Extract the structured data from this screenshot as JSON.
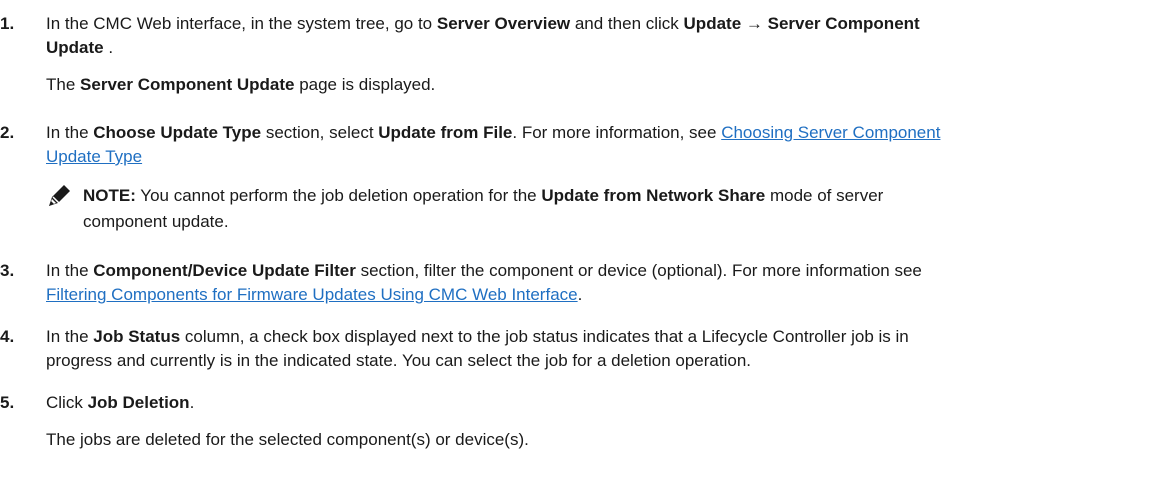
{
  "steps": [
    {
      "number": "1.",
      "line1": {
        "t1": "In the CMC Web interface, in the system tree, go to ",
        "b1": "Server Overview",
        "t2": " and then click ",
        "b2": "Update",
        "t3": " → ",
        "b3": "Server Component"
      },
      "line2": {
        "b1": "Update",
        "t1": " ."
      },
      "result": {
        "t1": "The ",
        "b1": "Server Component Update",
        "t2": " page is displayed."
      }
    },
    {
      "number": "2.",
      "line1": {
        "t1": "In the ",
        "b1": "Choose Update Type",
        "t2": " section, select ",
        "b2": "Update from File",
        "t3": ". For more information, see ",
        "link": "Choosing Server Component"
      },
      "line2": {
        "link": "Update Type"
      },
      "note": {
        "label": "NOTE:",
        "t1": " You cannot perform the job deletion operation for the ",
        "b1": "Update from Network Share",
        "t2": " mode of server",
        "line2": "component update."
      }
    },
    {
      "number": "3.",
      "line1": {
        "t1": "In the ",
        "b1": "Component/Device Update Filter",
        "t2": " section, filter the component or device (optional). For more information see"
      },
      "line2": {
        "link": "Filtering Components for Firmware Updates Using CMC Web Interface",
        "t1": "."
      }
    },
    {
      "number": "4.",
      "line1": {
        "t1": "In the ",
        "b1": "Job Status",
        "t2": " column, a check box displayed next to the job status indicates that a Lifecycle Controller job is in"
      },
      "line2": "progress and currently is in the indicated state. You can select the job for a deletion operation."
    },
    {
      "number": "5.",
      "line1": {
        "t1": "Click ",
        "b1": "Job Deletion",
        "t2": "."
      },
      "result": "The jobs are deleted for the selected component(s) or device(s)."
    }
  ],
  "colors": {
    "text": "#1a1a1a",
    "link": "#1f6fc2"
  },
  "icons": {
    "note": "pencil-note-icon"
  }
}
